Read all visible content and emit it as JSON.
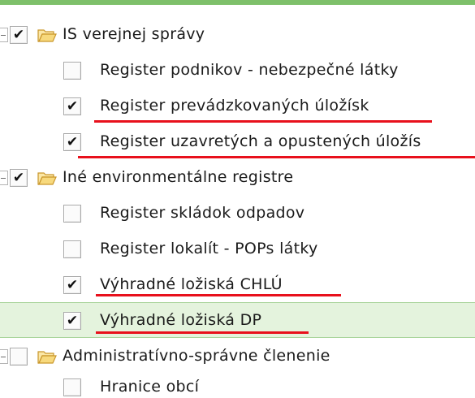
{
  "tree": {
    "group_is": {
      "label": "IS verejnej správy",
      "checked_mark": "✔",
      "items": [
        {
          "label": "Register podnikov - nebezpečné látky",
          "checked_mark": ""
        },
        {
          "label": "Register prevádzkovaných úložísk",
          "checked_mark": "✔"
        },
        {
          "label": "Register uzavretých a opustených úložís",
          "checked_mark": "✔"
        }
      ]
    },
    "group_env": {
      "label": "Iné environmentálne registre",
      "checked_mark": "✔",
      "items": [
        {
          "label": "Register skládok odpadov",
          "checked_mark": ""
        },
        {
          "label": "Register lokalít - POPs látky",
          "checked_mark": ""
        },
        {
          "label": "Výhradné ložiská CHLÚ",
          "checked_mark": "✔"
        },
        {
          "label": "Výhradné ložiská DP",
          "checked_mark": "✔"
        }
      ]
    },
    "group_admin": {
      "label": "Administratívno-správne členenie",
      "checked_mark": "",
      "items": [
        {
          "label": "Hranice obcí",
          "checked_mark": ""
        }
      ]
    }
  },
  "colors": {
    "top_bar": "#7ec06a",
    "selected_row": "#e4f3dd",
    "annotation_underline": "#e8101c",
    "folder_fill": "#f7d97d",
    "folder_stroke": "#c9962b"
  }
}
